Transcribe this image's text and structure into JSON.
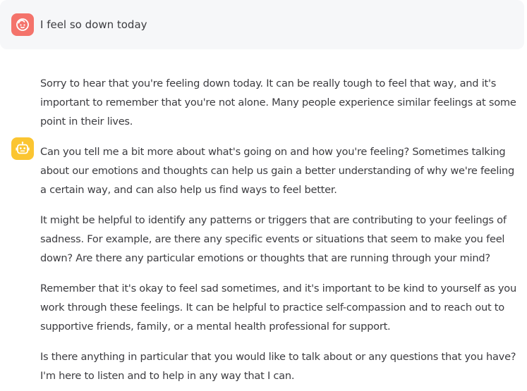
{
  "conversation": {
    "user_message": {
      "avatar_icon": "baby-face-icon",
      "avatar_color": "#f4736b",
      "text": "I feel so down today"
    },
    "assistant_message": {
      "avatar_icon": "robot-icon",
      "avatar_color": "#fbc531",
      "paragraphs": [
        "Sorry to hear that you're feeling down today. It can be really tough to feel that way, and it's important to remember that you're not alone. Many people experience similar feelings at some point in their lives.",
        "Can you tell me a bit more about what's going on and how you're feeling? Sometimes talking about our emotions and thoughts can help us gain a better understanding of why we're feeling a certain way, and can also help us find ways to feel better.",
        "It might be helpful to identify any patterns or triggers that are contributing to your feelings of sadness. For example, are there any specific events or situations that seem to make you feel down? Are there any particular emotions or thoughts that are running through your mind?",
        "Remember that it's okay to feel sad sometimes, and it's important to be kind to yourself as you work through these feelings. It can be helpful to practice self-compassion and to reach out to supportive friends, family, or a mental health professional for support.",
        "Is there anything in particular that you would like to talk about or any questions that you have? I'm here to listen and to help in any way that I can."
      ]
    }
  }
}
